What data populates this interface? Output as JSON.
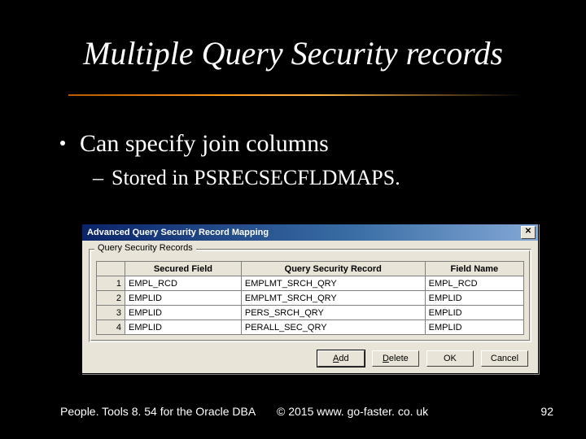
{
  "title": "Multiple Query Security records",
  "bullet1": "Can specify join columns",
  "bullet2": "Stored in PSRECSECFLDMAPS.",
  "dialog": {
    "title": "Advanced Query Security Record Mapping",
    "close_glyph": "✕",
    "groupbox_legend": "Query Security Records",
    "columns": {
      "secured_field": "Secured Field",
      "qsr": "Query Security Record",
      "field_name": "Field Name"
    },
    "rows": [
      {
        "n": "1",
        "secured_field": "EMPL_RCD",
        "qsr": "EMPLMT_SRCH_QRY",
        "field_name": "EMPL_RCD"
      },
      {
        "n": "2",
        "secured_field": "EMPLID",
        "qsr": "EMPLMT_SRCH_QRY",
        "field_name": "EMPLID"
      },
      {
        "n": "3",
        "secured_field": "EMPLID",
        "qsr": "PERS_SRCH_QRY",
        "field_name": "EMPLID"
      },
      {
        "n": "4",
        "secured_field": "EMPLID",
        "qsr": "PERALL_SEC_QRY",
        "field_name": "EMPLID"
      }
    ],
    "buttons": {
      "add_pre": "",
      "add_u": "A",
      "add_post": "dd",
      "delete_pre": "",
      "delete_u": "D",
      "delete_post": "elete",
      "ok": "OK",
      "cancel": "Cancel"
    }
  },
  "footer": {
    "left": "People. Tools 8. 54 for the Oracle DBA",
    "mid": "© 2015 www. go-faster. co. uk",
    "right": "92"
  }
}
